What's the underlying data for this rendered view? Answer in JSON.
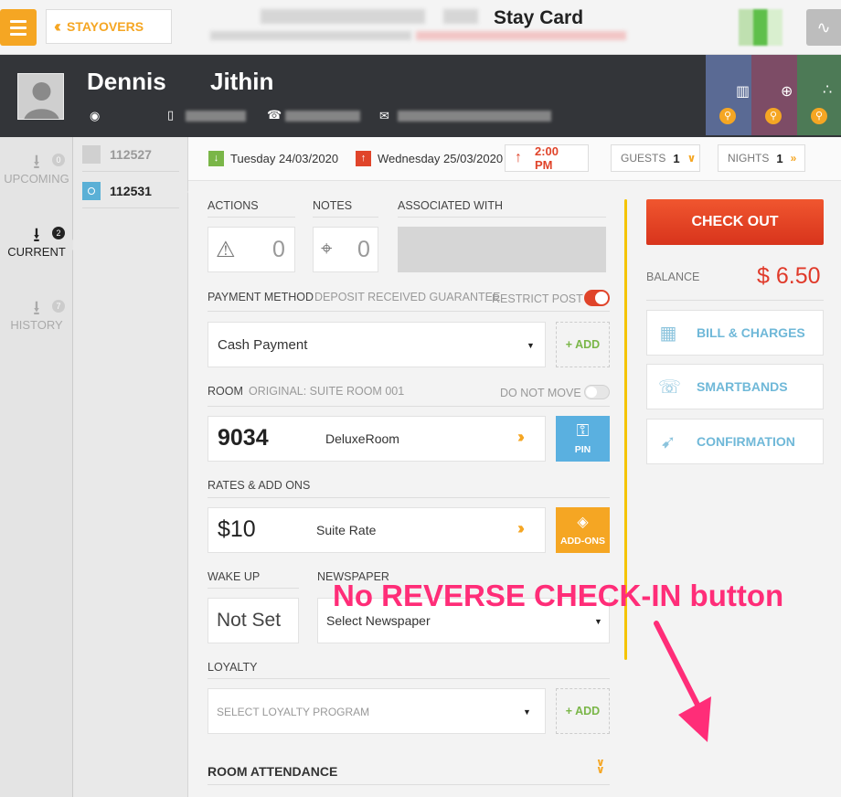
{
  "topbar": {
    "back_label": "STAYOVERS",
    "title": "Stay Card"
  },
  "guest": {
    "first_name": "Dennis",
    "last_name": "Jithin"
  },
  "left_nav": [
    {
      "label": "UPCOMING",
      "count": "0"
    },
    {
      "label": "CURRENT",
      "count": "2"
    },
    {
      "label": "HISTORY",
      "count": "7"
    }
  ],
  "reservations": [
    {
      "number": "112527"
    },
    {
      "number": "112531"
    }
  ],
  "dates": {
    "arrival": "Tuesday 24/03/2020",
    "departure": "Wednesday 25/03/2020",
    "departure_time": "2:00 PM",
    "guests_label": "GUESTS",
    "guests_value": "1",
    "nights_label": "NIGHTS",
    "nights_value": "1"
  },
  "actions": {
    "actions_label": "ACTIONS",
    "actions_count": "0",
    "notes_label": "NOTES",
    "notes_count": "0",
    "associated_label": "ASSOCIATED WITH"
  },
  "payment": {
    "label": "PAYMENT METHOD",
    "sublabel": "DEPOSIT RECEIVED GUARANTEE",
    "restrict_label": "RESTRICT POST",
    "method": "Cash Payment",
    "add_label": "+ ADD"
  },
  "room": {
    "label": "ROOM",
    "original": "ORIGINAL: SUITE ROOM 001",
    "do_not_move": "DO NOT MOVE",
    "number": "9034",
    "type": "DeluxeRoom",
    "pin_label": "PIN"
  },
  "rates": {
    "label": "RATES & ADD ONS",
    "amount": "$10",
    "name": "Suite Rate",
    "addons_label": "ADD-ONS"
  },
  "wake_up": {
    "label": "WAKE UP",
    "value": "Not Set"
  },
  "newspaper": {
    "label": "NEWSPAPER",
    "value": "Select Newspaper"
  },
  "loyalty": {
    "label": "LOYALTY",
    "placeholder": "SELECT LOYALTY PROGRAM",
    "add_label": "+ ADD"
  },
  "room_attendance": {
    "label": "ROOM ATTENDANCE"
  },
  "right_panel": {
    "checkout": "CHECK OUT",
    "balance_label": "BALANCE",
    "balance_value": "$ 6.50",
    "bill_charges": "BILL & CHARGES",
    "smartbands": "SMARTBANDS",
    "confirmation": "CONFIRMATION"
  },
  "annotation": {
    "text": "No REVERSE CHECK-IN button"
  },
  "colors": {
    "accent_orange": "#f5a623",
    "checkout_red": "#e0442a",
    "balance_red": "#e03a2a",
    "link_blue": "#6fb8d8",
    "annotation_pink": "#ff2d78"
  }
}
